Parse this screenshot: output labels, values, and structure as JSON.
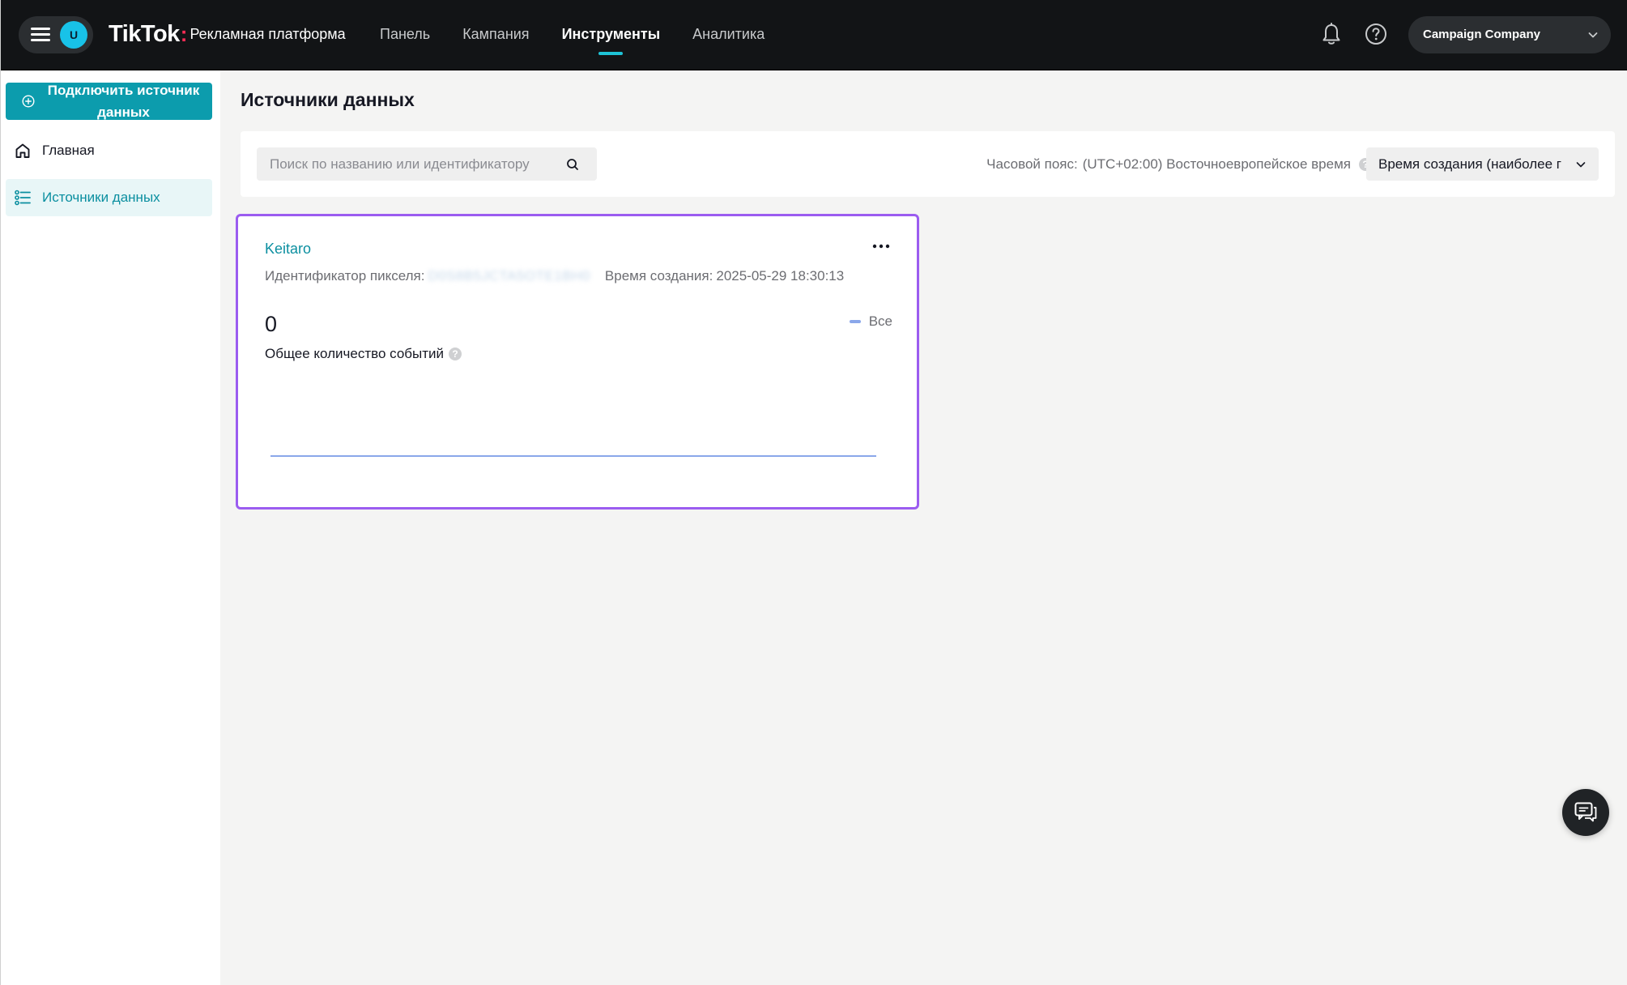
{
  "header": {
    "avatar_initial": "U",
    "brand_logo": "TikTok",
    "brand_colon": ":",
    "brand_sub": "Рекламная платформа",
    "nav": [
      {
        "label": "Панель",
        "active": false
      },
      {
        "label": "Кампания",
        "active": false
      },
      {
        "label": "Инструменты",
        "active": true
      },
      {
        "label": "Аналитика",
        "active": false
      }
    ],
    "icons": [
      "bell-icon",
      "help-circle-icon"
    ],
    "account_name": "Campaign Company"
  },
  "sidebar": {
    "connect_button": "Подключить источник данных",
    "items": [
      {
        "label": "Главная",
        "icon": "home-icon",
        "active": false
      },
      {
        "label": "Источники данных",
        "icon": "list-icon",
        "active": true
      }
    ]
  },
  "main": {
    "page_title": "Источники данных",
    "search": {
      "placeholder": "Поиск по названию или идентификатору",
      "value": ""
    },
    "timezone_label": "Часовой пояс:",
    "timezone_value": "(UTC+02:00) Восточноевропейское время",
    "sort_value": "Время создания (наиболее г"
  },
  "card": {
    "title": "Keitaro",
    "pixel_id_label": "Идентификатор пикселя:",
    "pixel_id_value": "D0S8B5JCTA5OTE1BH0",
    "created_label": "Время создания:",
    "created_value": "2025-05-29 18:30:13",
    "total_events_value": "0",
    "total_events_label": "Общее количество событий",
    "legend_label": "Все"
  },
  "colors": {
    "accent": "#0c9cad",
    "nav_indicator": "#1ec3d6",
    "card_highlight": "#9b5cf0",
    "series_line": "#8aa7ea",
    "topbar": "#121416"
  },
  "chart_data": {
    "type": "line",
    "series": [
      {
        "name": "Все",
        "values": [
          0,
          0,
          0,
          0,
          0,
          0,
          0
        ]
      }
    ],
    "ylim": [
      0,
      1
    ]
  }
}
